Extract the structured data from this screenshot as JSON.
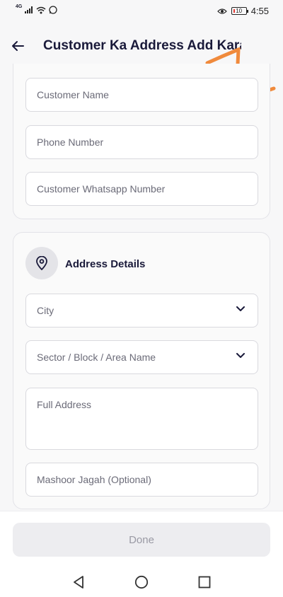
{
  "status_bar": {
    "network_label": "4G",
    "battery": "10",
    "time": "4:55"
  },
  "header": {
    "title": "Customer Ka Address Add Karain",
    "annotation": "1"
  },
  "customer_section": {
    "fields": [
      {
        "placeholder": "Customer Name"
      },
      {
        "placeholder": "Phone Number"
      },
      {
        "placeholder": "Customer Whatsapp Number"
      }
    ]
  },
  "address_section": {
    "title": "Address Details",
    "city_placeholder": "City",
    "area_placeholder": "Sector / Block / Area Name",
    "full_address_placeholder": "Full Address",
    "landmark_placeholder": "Mashoor Jagah (Optional)"
  },
  "footer": {
    "done_label": "Done"
  },
  "icons": {
    "back": "arrow-left-icon",
    "location": "location-pin-icon",
    "dropdown": "chevron-down-icon",
    "nav_back": "triangle-back-icon",
    "nav_home": "circle-home-icon",
    "nav_recent": "square-recent-icon"
  },
  "colors": {
    "annotation": "#f08a3c",
    "title": "#1a1a3a",
    "done_disabled_bg": "#ededf0",
    "done_disabled_text": "#9a9aa4"
  }
}
